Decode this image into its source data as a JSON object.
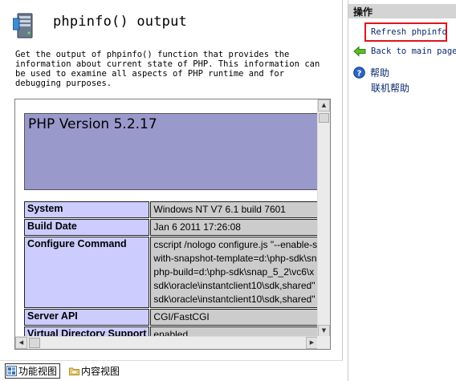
{
  "main": {
    "title": "phpinfo() output",
    "description": "Get the output of phpinfo() function that provides the information about current state of PHP. This information can be used to examine all aspects of PHP runtime and for debugging purposes.",
    "phpinfo": {
      "version": "PHP Version 5.2.17",
      "rows": [
        {
          "key": "System",
          "value": [
            "Windows NT V7 6.1 build 7601"
          ]
        },
        {
          "key": "Build Date",
          "value": [
            "Jan 6 2011 17:26:08"
          ]
        },
        {
          "key": "Configure Command",
          "value": [
            "cscript /nologo configure.js \"--enable-snap",
            "with-snapshot-template=d:\\php-sdk\\snap",
            "php-build=d:\\php-sdk\\snap_5_2\\vc6\\x",
            "sdk\\oracle\\instantclient10\\sdk,shared\" \"",
            "sdk\\oracle\\instantclient10\\sdk,shared\" \""
          ]
        },
        {
          "key": "Server API",
          "value": [
            "CGI/FastCGI"
          ]
        },
        {
          "key": "Virtual Directory Support",
          "value": [
            "enabled"
          ]
        }
      ]
    },
    "scroll": {
      "up": "▲",
      "down": "▼",
      "left": "◀",
      "right": "▶"
    }
  },
  "tabs": {
    "features_view": "功能视图",
    "content_view": "内容视图"
  },
  "actions": {
    "header": "操作",
    "refresh": "Refresh phpinfo",
    "back": "Back to main page",
    "help": "帮助",
    "online_help": "联机帮助"
  },
  "icons": {
    "header": "server-icon",
    "back": "green-arrow-left-icon",
    "help": "help-question-icon",
    "features": "features-view-icon",
    "content": "content-view-folder-icon"
  },
  "colors": {
    "php_header": "#9999cc",
    "key_cell": "#ccccff",
    "value_cell": "#cccccc",
    "highlight_border": "#e0141e",
    "link": "#0a2a6e"
  }
}
